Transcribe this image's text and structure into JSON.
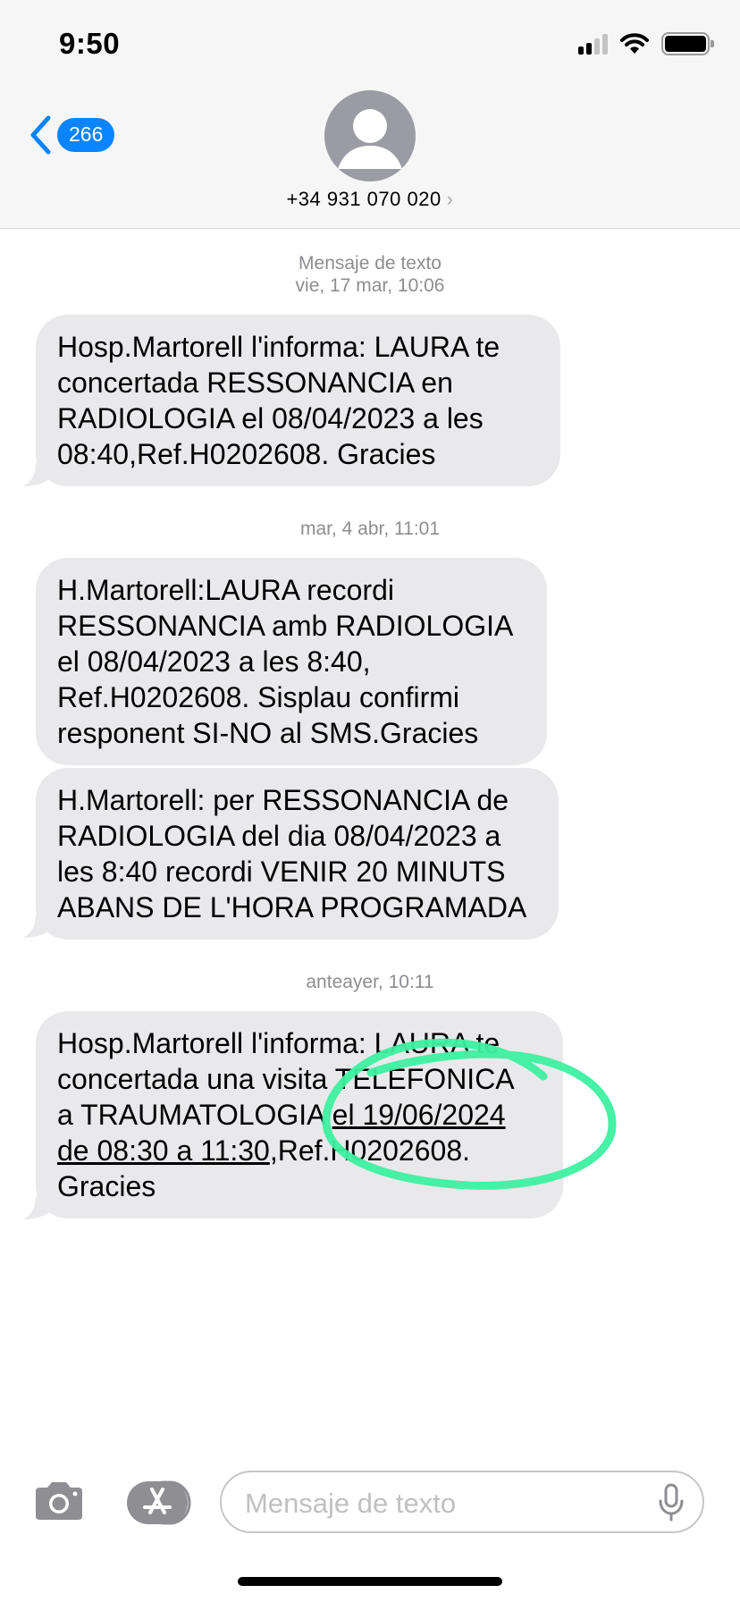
{
  "status": {
    "time": "9:50"
  },
  "header": {
    "back_count": "266",
    "contact": "+34 931 070 020",
    "contact_chevron": "›"
  },
  "threads": [
    {
      "label": "Mensaje de texto",
      "time": "vie, 17 mar, 10:06",
      "messages": [
        {
          "lines": [
            "Hosp.Martorell l'informa: LAURA te",
            "concertada RESSONANCIA en",
            "RADIOLOGIA el 08/04/2023 a les",
            "08:40,Ref.H0202608. Gracies"
          ]
        }
      ]
    },
    {
      "time": "mar, 4 abr, 11:01",
      "messages": [
        {
          "lines": [
            "H.Martorell:LAURA recordi",
            "RESSONANCIA amb RADIOLOGIA",
            "el 08/04/2023 a les 8:40,",
            "Ref.H0202608. Sisplau confirmi",
            "responent SI-NO al SMS.Gracies"
          ]
        },
        {
          "lines": [
            "H.Martorell: per RESSONANCIA de",
            "RADIOLOGIA del dia 08/04/2023 a",
            "les 8:40 recordi VENIR 20 MINUTS",
            "ABANS DE L'HORA PROGRAMADA"
          ]
        }
      ]
    },
    {
      "time": "anteayer, 10:11",
      "messages": [
        {
          "line1": "Hosp.Martorell l'informa: LAURA te",
          "line2": "concertada una visita TELEFONICA",
          "line3_a": "a TRAUMATOLOGIA ",
          "line3_link": "el 19/06/2024",
          "line4_link": "de 08:30 a 11:30",
          "line4_b": ",Ref.H0202608.",
          "line5": "Gracies"
        }
      ]
    }
  ],
  "composer": {
    "placeholder": "Mensaje de texto"
  },
  "colors": {
    "accent": "#0a84ff",
    "bubble": "#e9e9eb",
    "annotation": "#3df0a0"
  }
}
